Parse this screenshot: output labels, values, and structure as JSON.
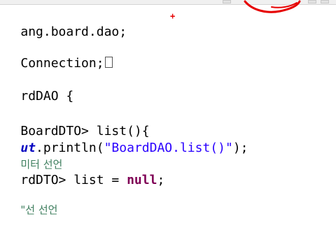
{
  "editor": {
    "lines": [
      {
        "text": "ang.board.dao;"
      },
      {
        "text": "Connection;"
      },
      {
        "text": "rdDAO {"
      },
      {
        "prefix": "BoardDTO> list(){"
      },
      {
        "field": "ut",
        "mid": ".println(",
        "str": "\"BoardDAO.list()\"",
        "end": ");"
      },
      {
        "comment": "미터 선언"
      },
      {
        "prefix": "rdDTO> list = ",
        "kw": "null",
        "end": ";"
      },
      {
        "comment": "\"선 선언"
      }
    ]
  },
  "annotation": {
    "crosshair": "+",
    "color": "#e60000"
  }
}
